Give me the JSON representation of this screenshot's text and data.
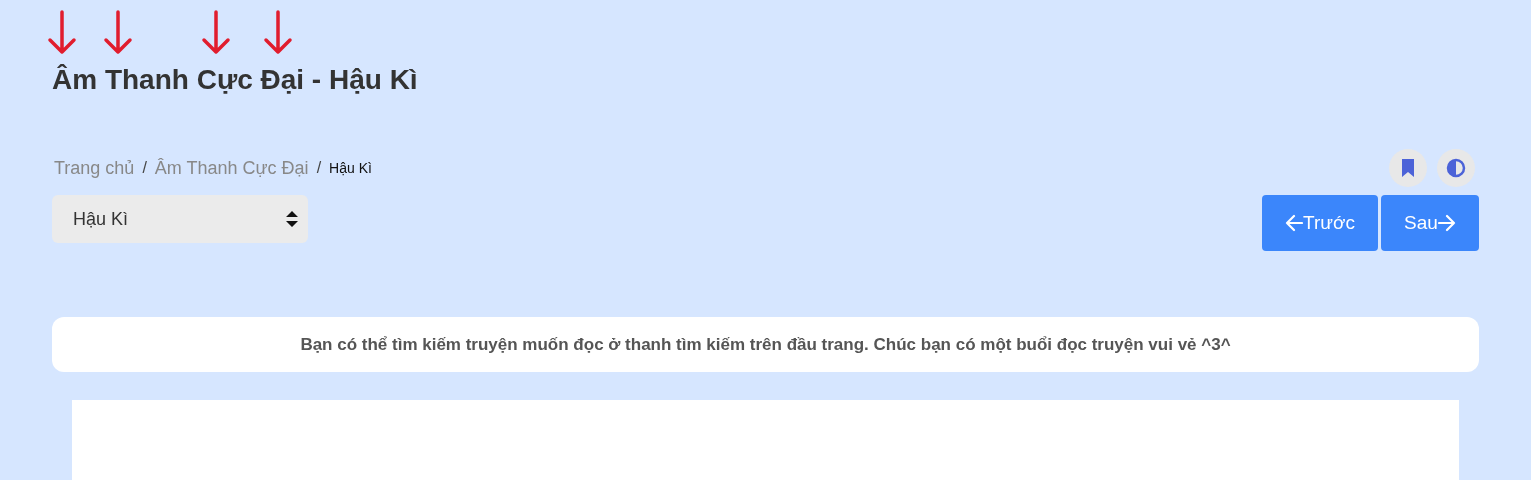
{
  "title": "Âm Thanh Cực Đại - Hậu Kì",
  "breadcrumb": [
    {
      "label": "Trang chủ",
      "current": false
    },
    {
      "label": "Âm Thanh Cực Đại",
      "current": false
    },
    {
      "label": "Hậu Kì",
      "current": true
    }
  ],
  "breadcrumb_separator": "/",
  "chapter_select": {
    "value": "Hậu Kì"
  },
  "nav_buttons": [
    {
      "label": "Trước",
      "kind": "prev"
    },
    {
      "label": "Sau",
      "kind": "next"
    }
  ],
  "notice": "Bạn có thể tìm kiếm truyện muốn đọc ở thanh tìm kiếm trên đầu trang. Chúc bạn có một buổi đọc truyện vui vẻ ^3^"
}
